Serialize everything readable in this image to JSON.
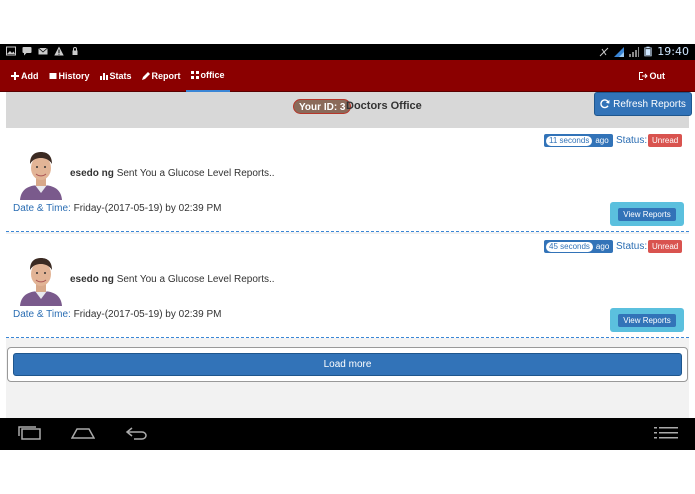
{
  "status_bar": {
    "time": "19:40",
    "left_icons": [
      "image-icon",
      "message-icon",
      "mail-icon",
      "warning-icon",
      "lock-icon"
    ],
    "right_icons": [
      "no-sync-icon",
      "signal-icon",
      "signal-icon-2",
      "battery-icon"
    ]
  },
  "nav": {
    "items": [
      {
        "label": "Add",
        "icon": "plus-icon"
      },
      {
        "label": "History",
        "icon": "square-icon"
      },
      {
        "label": "Stats",
        "icon": "bar-chart-icon"
      },
      {
        "label": "Report",
        "icon": "pencil-icon"
      },
      {
        "label": "office",
        "icon": "grid-icon"
      }
    ],
    "active": "office",
    "out_label": "Out"
  },
  "header": {
    "id_label": "Your ID: 3",
    "title": "Doctors Office",
    "refresh_label": "Refresh Reports"
  },
  "reports": [
    {
      "elapsed": "11 seconds",
      "ago": "ago",
      "status_label": "Status:",
      "status": "Unread",
      "sender": "esedo ng",
      "message": "Sent You a Glucose Level Reports..",
      "datetime_label": "Date & Time:",
      "datetime": "Friday-(2017-05-19) by 02:39 PM",
      "button": "View Reports"
    },
    {
      "elapsed": "45 seconds",
      "ago": "ago",
      "status_label": "Status:",
      "status": "Unread",
      "sender": "esedo ng",
      "message": "Sent You a Glucose Level Reports..",
      "datetime_label": "Date & Time:",
      "datetime": "Friday-(2017-05-19) by 02:39 PM",
      "button": "View Reports"
    }
  ],
  "load_more": "Load more",
  "colors": {
    "navbar": "#8b0000",
    "primary": "#3273b8",
    "info": "#5bc0de",
    "danger": "#d9534f",
    "link": "#2a6db3"
  }
}
